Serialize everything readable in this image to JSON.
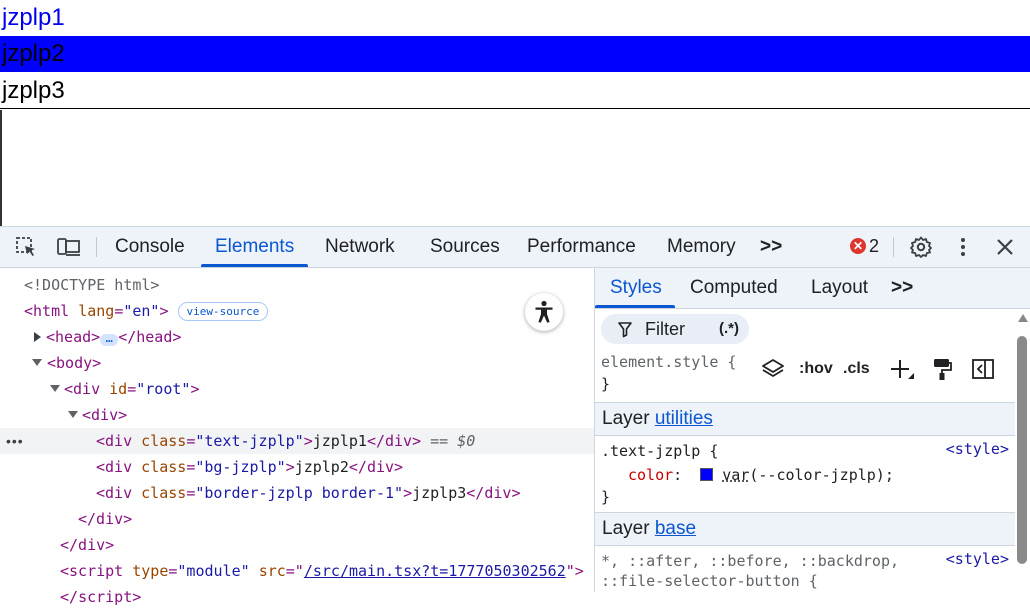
{
  "page": {
    "lines": [
      "jzplp1",
      "jzplp2",
      "jzplp3"
    ]
  },
  "devtools": {
    "tabs": [
      "Console",
      "Elements",
      "Network",
      "Sources",
      "Performance",
      "Memory"
    ],
    "active_tab": "Elements",
    "more_tabs": ">>",
    "error_count": "2",
    "icons": [
      "inspect-element-icon",
      "device-toolbar-icon",
      "error-icon",
      "settings-gear-icon",
      "kebab-menu-icon",
      "close-icon"
    ]
  },
  "elements": {
    "doctype": "<!DOCTYPE html>",
    "html_tag": "html",
    "html_attr": "lang",
    "html_val": "\"en\"",
    "view_source": "view-source",
    "head_open": "<head>",
    "head_close": "</head>",
    "ellipsis": "…",
    "body_open": "<body>",
    "root_tag": "div",
    "root_attr": "id",
    "root_val": "\"root\"",
    "div_open": "<div>",
    "sel_dots": "•••",
    "div1_class": "\"text-jzplp\"",
    "div1_text": "jzplp1",
    "div2_class": "\"bg-jzplp\"",
    "div2_text": "jzplp2",
    "div3_class": "\"border-jzplp border-1\"",
    "div3_text": "jzplp3",
    "div_close": "</div>",
    "selected_marker": "== $0",
    "script_attr1": "type",
    "script_val1": "\"module\"",
    "script_attr2": "src",
    "script_src": "/src/main.tsx?t=1777050302562",
    "class_attr": "class",
    "div_tag": "div",
    "script_tag": "script"
  },
  "styles": {
    "tabs": [
      "Styles",
      "Computed",
      "Layout"
    ],
    "active_tab": "Styles",
    "more": ">>",
    "filter_label": "Filter",
    "regex_label": "(.*)",
    "hov": ":hov",
    "cls": ".cls",
    "element_style": "element.style {",
    "close_brace": "}",
    "layer_label": "Layer",
    "layer1": "utilities",
    "rule1_selector": ".text-jzplp {",
    "rule1_source": "<style>",
    "rule1_prop": "color",
    "rule1_value_fn": "var",
    "rule1_value_arg": "(--color-jzplp);",
    "layer2": "base",
    "rule2_selector_line1": "*, ::after, ::before, ::backdrop,",
    "rule2_selector_line2": "::file-selector-button {",
    "rule2_source": "<style>",
    "swatch_color": "#0000ff"
  }
}
